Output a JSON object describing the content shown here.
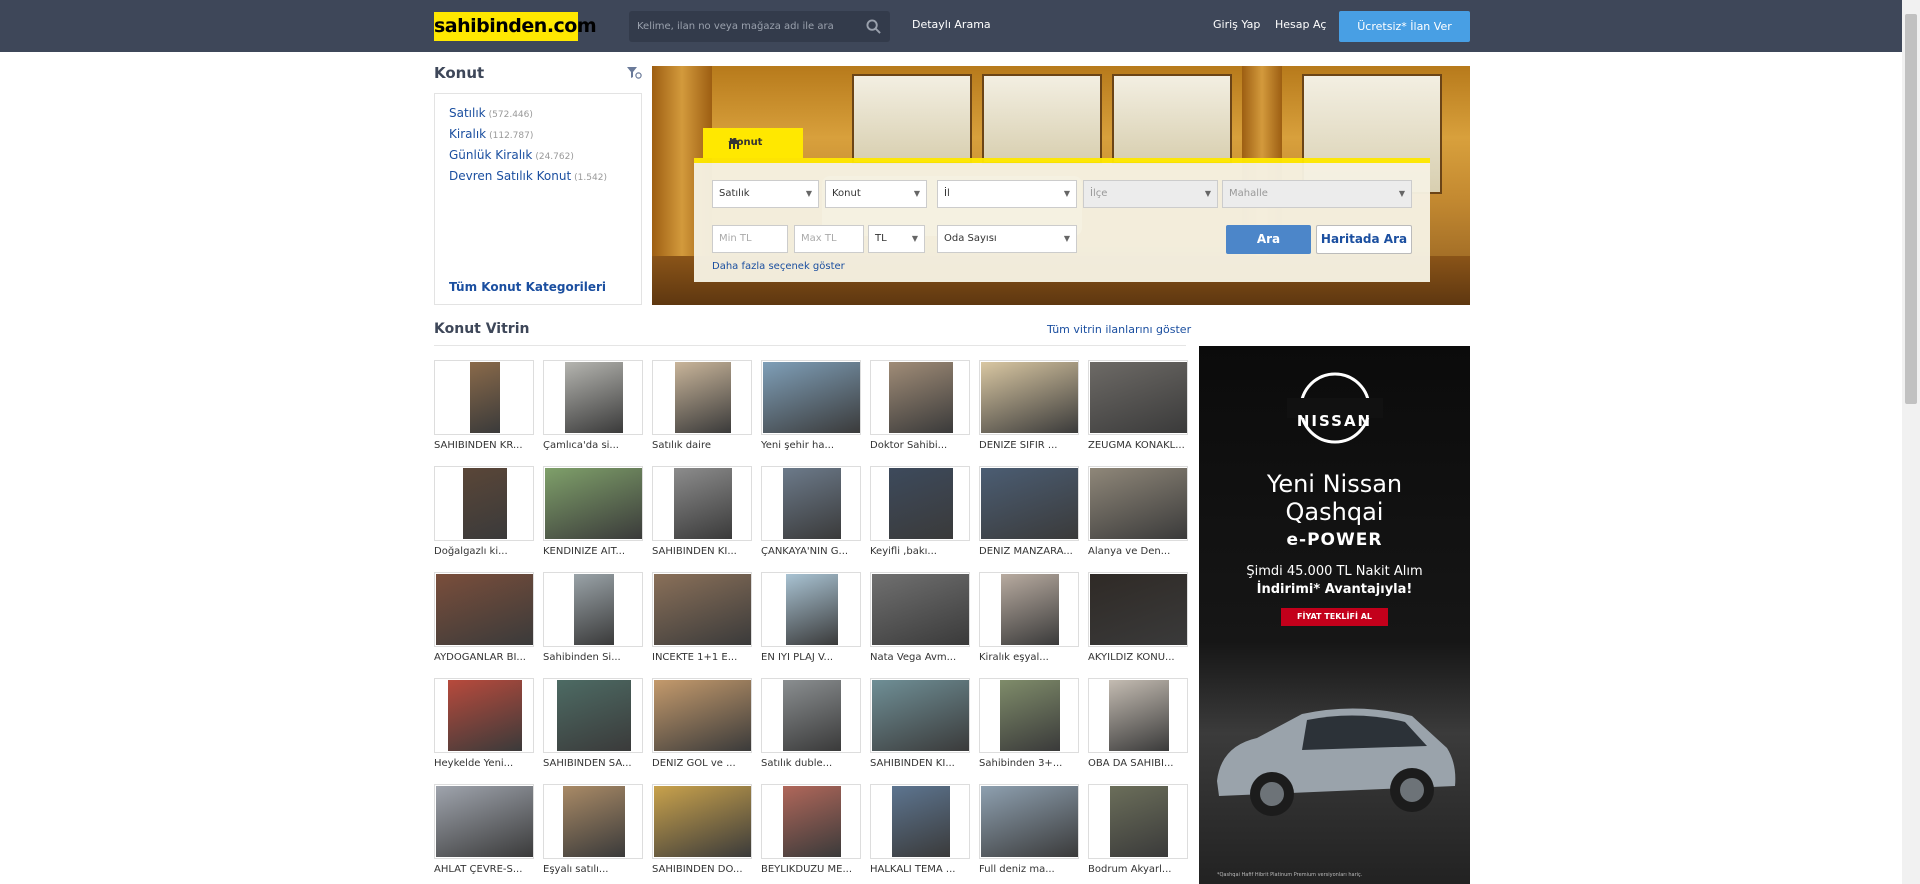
{
  "header": {
    "logo": "sahibinden.com",
    "search_placeholder": "Kelime, ilan no veya mağaza adı ile ara",
    "detailed_search": "Detaylı Arama",
    "login": "Giriş Yap",
    "register": "Hesap Aç",
    "post_ad": "Ücretsiz* İlan Ver"
  },
  "sidebar": {
    "title": "Konut",
    "categories": [
      {
        "label": "Satılık",
        "count": "(572.446)"
      },
      {
        "label": "Kiralık",
        "count": "(112.787)"
      },
      {
        "label": "Günlük Kiralık",
        "count": "(24.762)"
      },
      {
        "label": "Devren Satılık Konut",
        "count": "(1.542)"
      }
    ],
    "all_categories": "Tüm Konut Kategorileri"
  },
  "search_panel": {
    "tab": "Konut",
    "type": "Satılık",
    "category": "Konut",
    "il": "İl",
    "ilce": "İlçe",
    "mahalle": "Mahalle",
    "min_price": "Min TL",
    "max_price": "Max TL",
    "currency": "TL",
    "rooms": "Oda Sayısı",
    "search_btn": "Ara",
    "map_btn": "Haritada Ara",
    "more_options": "Daha fazla seçenek göster"
  },
  "showcase": {
    "title": "Konut Vitrin",
    "show_all": "Tüm vitrin ilanlarını göster",
    "items": [
      "SAHİBİNDEN KR...",
      "Çamlıca'da si...",
      "Satılık daire",
      "Yeni şehir ha...",
      "Doktor Sahibi...",
      "DENİZE SIFIR ...",
      "ZEUGMA KONAKL...",
      "Doğalgazlı ki...",
      "KENDİNİZE AİT...",
      "SAHİBİNDEN Kİ...",
      "ÇANKAYA'NIN G...",
      "Keyifli ,bakı...",
      "DENİZ MANZARA...",
      "Alanya ve Den...",
      "AYDOĞANLAR Bİ...",
      "Sahibinden Si...",
      "İNCEKTE 1+1  E...",
      "EN İYİ PLAJ V...",
      "Nata Vega Avm...",
      "Kiralık eşyal...",
      "AKYILDIZ KONU...",
      "Heykelde Yeni...",
      "SAHİBİNDEN SA...",
      "DENİZ GÖL ve ...",
      "Satılık duble...",
      "SAHİBİNDEN Kİ...",
      "Sahibinden 3+...",
      "OBA DA SAHİBİ...",
      "AHLAT ÇEVRE-S...",
      "Eşyalı satılı...",
      "SAHİBİNDEN DO...",
      "BEYLİKDÜZÜ ME...",
      "HALKALI TEMA ...",
      "Full deniz ma...",
      "Bodrum Akyarl..."
    ],
    "thumb_colors": [
      "#8a6a4a",
      "#b5b5b0",
      "#c9b59a",
      "#7f9fb8",
      "#a08c77",
      "#d9c7a2",
      "#6d6a66",
      "#5a4638",
      "#7fa06a",
      "#8c8c8c",
      "#6c7a8a",
      "#3d4a5c",
      "#4b5d73",
      "#8f8779",
      "#7a4e3b",
      "#9aa3a8",
      "#8a7059",
      "#a9c3d3",
      "#707070",
      "#b8aba0",
      "#2f2a26",
      "#b84a3c",
      "#4d6b64",
      "#c49a6c",
      "#8a8e90",
      "#6f8f96",
      "#7f8c6a",
      "#c4bcb2",
      "#9fa4ad",
      "#a98a66",
      "#c9a24c",
      "#b0675a",
      "#5d7590",
      "#8ea0b0",
      "#6b6e5a"
    ]
  },
  "ad": {
    "brand": "NISSAN",
    "headline1": "Yeni Nissan",
    "headline2": "Qashqai",
    "badge": "e-POWER",
    "offer1": "Şimdi 45.000 TL Nakit Alım",
    "offer2": "İndirimi* Avantajıyla!",
    "cta": "FİYAT TEKLİFİ AL",
    "fine_print": "*Qashqai Hafif Hibrit Platinum Premium versiyonları hariç."
  }
}
